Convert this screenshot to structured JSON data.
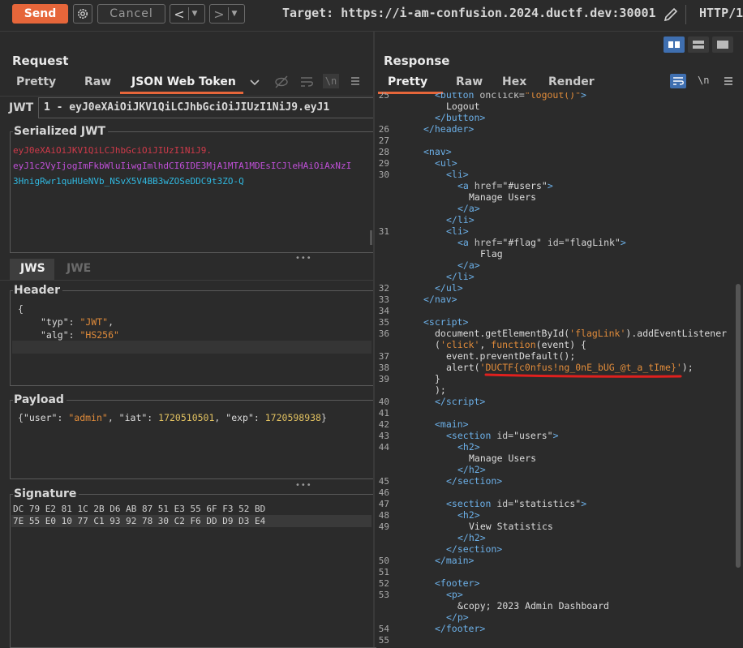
{
  "toolbar": {
    "send_label": "Send",
    "cancel_label": "Cancel",
    "back_label": "<",
    "forward_label": ">",
    "target_text": "Target: https://i-am-confusion.2024.ductf.dev:30001",
    "http_version": "HTTP/1"
  },
  "request": {
    "title": "Request",
    "tabs": [
      "Pretty",
      "Raw",
      "JSON Web Token"
    ],
    "active_tab": "JSON Web Token",
    "jwt_label": "JWT",
    "jwt_select_value": "1 - eyJ0eXAiOiJKV1QiLCJhbGciOiJIUzI1NiJ9.eyJ1",
    "serialized_title": "Serialized JWT",
    "serialized_lines": [
      "eyJ0eXAiOiJKV1QiLCJhbGciOiJIUzI1NiJ9.",
      "eyJ1c2VyIjogImFkbWluIiwgImlhdCI6IDE3MjA1MTA1MDEsICJleHAiOiAxNzI",
      "3HnigRwr1quHUeNVb_NSvX5V4BB3wZOSeDDC9t3ZO-Q"
    ],
    "jws_tab": "JWS",
    "jwe_tab": "JWE",
    "header_title": "Header",
    "header_json": {
      "open": "{",
      "typ_key": "\"typ\"",
      "typ_val": "\"JWT\"",
      "alg_key": "\"alg\"",
      "alg_val": "\"HS256\"",
      "close": "}"
    },
    "payload_title": "Payload",
    "payload": {
      "open": "{",
      "user_key": "\"user\"",
      "user_val": "\"admin\"",
      "iat_key": "\"iat\"",
      "iat_val": "1720510501",
      "exp_key": "\"exp\"",
      "exp_val": "1720598938",
      "close": "}"
    },
    "signature_title": "Signature",
    "signature_lines": [
      "DC 79 E2 81 1C 2B D6 AB 87 51 E3 55 6F F3 52 BD",
      "7E 55 E0 10 77 C1 93 92 78 30 C2 F6 DD D9 D3 E4"
    ]
  },
  "response": {
    "title": "Response",
    "tabs": [
      "Pretty",
      "Raw",
      "Hex",
      "Render"
    ],
    "active_tab": "Pretty",
    "newline_label": "\\n",
    "line_numbers": [
      "25",
      "26",
      "27",
      "28",
      "29",
      "30",
      "31",
      "32",
      "33",
      "34",
      "35",
      "36",
      "37",
      "38",
      "39",
      "40",
      "41",
      "42",
      "43",
      "44",
      "45",
      "46",
      "47",
      "48",
      "49",
      "50",
      "51",
      "52",
      "53",
      "54",
      "55"
    ],
    "flag_value": "'DUCTF{c0nfus!ng_0nE_bUG_@t_a_tIme}'"
  },
  "colors": {
    "accent": "#e6663a",
    "underline_annotation": "#e0201e"
  }
}
